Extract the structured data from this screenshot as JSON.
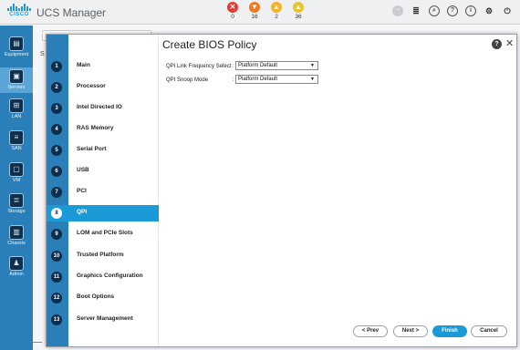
{
  "app": {
    "title": "UCS Manager",
    "logo_text": "CISCO"
  },
  "faults": [
    {
      "icon": "critical-icon",
      "symbol": "✕",
      "count": "0",
      "color": "#e03c31"
    },
    {
      "icon": "major-icon",
      "symbol": "▼",
      "count": "16",
      "color": "#f07a22"
    },
    {
      "icon": "minor-icon",
      "symbol": "▲",
      "count": "2",
      "color": "#f5b324"
    },
    {
      "icon": "warning-icon",
      "symbol": "▲",
      "count": "36",
      "color": "#e9c431"
    }
  ],
  "toolbar": [
    {
      "name": "status-icon",
      "symbol": "◔"
    },
    {
      "name": "menu-icon",
      "symbol": "≣"
    },
    {
      "name": "search-icon",
      "symbol": "⌕"
    },
    {
      "name": "help-icon",
      "symbol": "?"
    },
    {
      "name": "info-icon",
      "symbol": "i"
    },
    {
      "name": "settings-icon",
      "symbol": "⚙"
    },
    {
      "name": "exit-icon",
      "symbol": "⏻"
    }
  ],
  "nav": [
    {
      "label": "Equipment",
      "symbol": "▤"
    },
    {
      "label": "Servers",
      "symbol": "▣"
    },
    {
      "label": "LAN",
      "symbol": "⊞"
    },
    {
      "label": "SAN",
      "symbol": "≡"
    },
    {
      "label": "VM",
      "symbol": "▢"
    },
    {
      "label": "Storage",
      "symbol": "≣"
    },
    {
      "label": "Chassis",
      "symbol": "▥"
    },
    {
      "label": "Admin",
      "symbol": "♟"
    }
  ],
  "background": {
    "s_label": "S"
  },
  "dialog": {
    "title": "Create BIOS Policy",
    "help": "?",
    "close": "✕",
    "steps": [
      {
        "num": "1",
        "label": "Main"
      },
      {
        "num": "2",
        "label": "Processor"
      },
      {
        "num": "3",
        "label": "Intel Directed IO"
      },
      {
        "num": "4",
        "label": "RAS Memory"
      },
      {
        "num": "5",
        "label": "Serial Port"
      },
      {
        "num": "6",
        "label": "USB"
      },
      {
        "num": "7",
        "label": "PCI"
      },
      {
        "num": "8",
        "label": "QPI",
        "active": true
      },
      {
        "num": "9",
        "label": "LOM and PCIe Slots"
      },
      {
        "num": "10",
        "label": "Trusted Platform"
      },
      {
        "num": "11",
        "label": "Graphics Configuration"
      },
      {
        "num": "12",
        "label": "Boot Options"
      },
      {
        "num": "13",
        "label": "Server Management"
      }
    ],
    "fields": [
      {
        "label": "QPI Link Frequency Select :",
        "colon": "",
        "value": "Platform Default"
      },
      {
        "label": "QPI Snoop Mode",
        "colon": ":",
        "value": "Platform Default"
      }
    ],
    "buttons": {
      "prev": "< Prev",
      "next": "Next >",
      "finish": "Finish",
      "cancel": "Cancel"
    }
  },
  "colors": {
    "accent": "#1b9ad8",
    "nav_bg": "#2a7fb8",
    "step_num_bg": "#0b2e4d"
  }
}
